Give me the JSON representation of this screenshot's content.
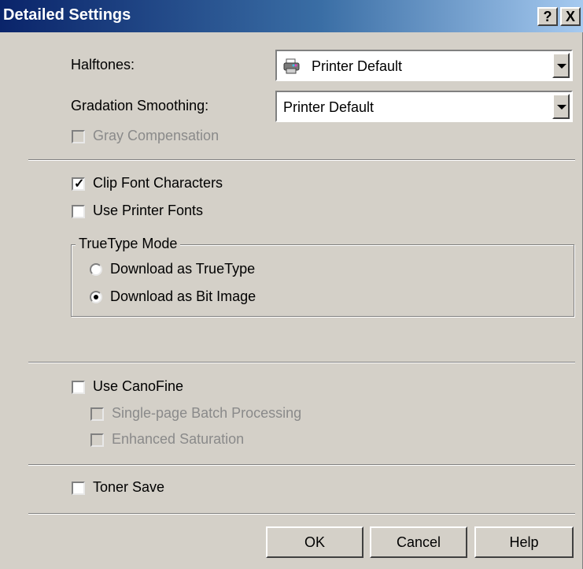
{
  "window": {
    "title": "Detailed Settings",
    "help_button": "?",
    "close_button": "X"
  },
  "halftones": {
    "label": "Halftones:",
    "value": "Printer Default",
    "icon": "printer-icon"
  },
  "gradation": {
    "label": "Gradation Smoothing:",
    "value": "Printer Default"
  },
  "gray_compensation": {
    "label": "Gray Compensation",
    "checked": false,
    "enabled": false
  },
  "clip_font": {
    "label": "Clip Font Characters",
    "checked": true
  },
  "printer_fonts": {
    "label": "Use Printer Fonts",
    "checked": false
  },
  "truetype_mode": {
    "legend": "TrueType Mode",
    "options": [
      {
        "label": "Download as TrueType",
        "selected": false
      },
      {
        "label": "Download as Bit Image",
        "selected": true
      }
    ]
  },
  "canofine": {
    "label": "Use CanoFine",
    "checked": false
  },
  "single_page": {
    "label": "Single-page Batch Processing",
    "checked": false,
    "enabled": false
  },
  "enhanced_saturation": {
    "label": "Enhanced Saturation",
    "checked": false,
    "enabled": false
  },
  "toner_save": {
    "label": "Toner Save",
    "checked": false
  },
  "buttons": {
    "ok": "OK",
    "cancel": "Cancel",
    "help": "Help"
  }
}
